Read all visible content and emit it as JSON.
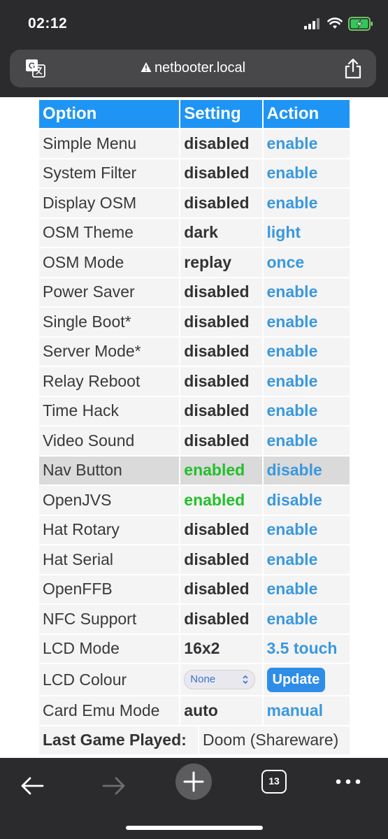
{
  "status_bar": {
    "time": "02:12"
  },
  "browser": {
    "url": "netbooter.local",
    "tab_count": "13"
  },
  "table": {
    "headers": {
      "option": "Option",
      "setting": "Setting",
      "action": "Action"
    },
    "rows": [
      {
        "option": "Simple Menu",
        "setting": "disabled",
        "action": "enable"
      },
      {
        "option": "System Filter",
        "setting": "disabled",
        "action": "enable"
      },
      {
        "option": "Display OSM",
        "setting": "disabled",
        "action": "enable"
      },
      {
        "option": "OSM Theme",
        "setting": "dark",
        "action": "light"
      },
      {
        "option": "OSM Mode",
        "setting": "replay",
        "action": "once"
      },
      {
        "option": "Power Saver",
        "setting": "disabled",
        "action": "enable"
      },
      {
        "option": "Single Boot*",
        "setting": "disabled",
        "action": "enable"
      },
      {
        "option": "Server Mode*",
        "setting": "disabled",
        "action": "enable"
      },
      {
        "option": "Relay Reboot",
        "setting": "disabled",
        "action": "enable"
      },
      {
        "option": "Time Hack",
        "setting": "disabled",
        "action": "enable"
      },
      {
        "option": "Video Sound",
        "setting": "disabled",
        "action": "enable"
      },
      {
        "option": "Nav Button",
        "setting": "enabled",
        "action": "disable"
      },
      {
        "option": "OpenJVS",
        "setting": "enabled",
        "action": "disable"
      },
      {
        "option": "Hat Rotary",
        "setting": "disabled",
        "action": "enable"
      },
      {
        "option": "Hat Serial",
        "setting": "disabled",
        "action": "enable"
      },
      {
        "option": "OpenFFB",
        "setting": "disabled",
        "action": "enable"
      },
      {
        "option": "NFC Support",
        "setting": "disabled",
        "action": "enable"
      },
      {
        "option": "LCD Mode",
        "setting": "16x2",
        "action": "3.5 touch"
      }
    ],
    "lcd_colour": {
      "option": "LCD Colour",
      "select_value": "None",
      "button": "Update"
    },
    "card_emu": {
      "option": "Card Emu Mode",
      "setting": "auto",
      "action": "manual"
    }
  },
  "last_game": {
    "label": "Last Game Played:",
    "value": "Doom (Shareware)"
  },
  "colors": {
    "header_bg": "#1e95f4",
    "link": "#3a98de",
    "enabled": "#22c02a",
    "chrome": "#2b2b2d"
  }
}
